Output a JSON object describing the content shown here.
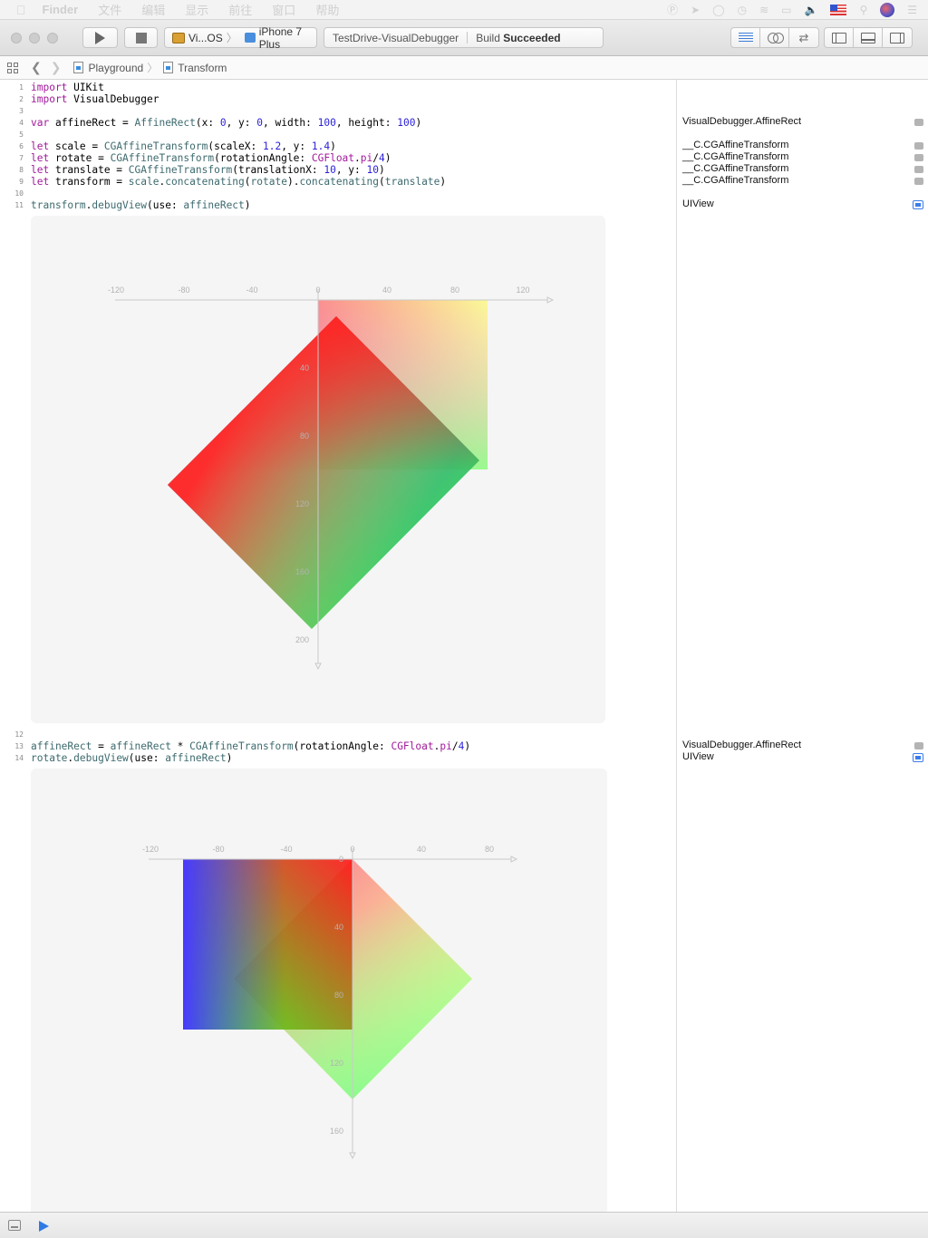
{
  "menubar": {
    "app_name": "Finder",
    "items": [
      "文件",
      "编辑",
      "显示",
      "前往",
      "窗口",
      "帮助"
    ]
  },
  "toolbar": {
    "scheme": "Vi...OS",
    "device": "iPhone 7 Plus",
    "activity_project": "TestDrive-VisualDebugger",
    "activity_status_prefix": "Build",
    "activity_status": "Succeeded"
  },
  "jumpbar": {
    "crumbs": [
      "Playground",
      "Transform"
    ]
  },
  "code": {
    "lines": [
      {
        "n": "1"
      },
      {
        "n": "2"
      },
      {
        "n": "3"
      },
      {
        "n": "4"
      },
      {
        "n": "5"
      },
      {
        "n": "6"
      },
      {
        "n": "7"
      },
      {
        "n": "8"
      },
      {
        "n": "9"
      },
      {
        "n": "10"
      },
      {
        "n": "11"
      },
      {
        "n": "12"
      },
      {
        "n": "13"
      },
      {
        "n": "14"
      }
    ],
    "l1": [
      "import",
      " UIKit"
    ],
    "l2": [
      "import",
      " VisualDebugger"
    ],
    "l4": [
      "var",
      " affineRect = ",
      "AffineRect",
      "(x: ",
      "0",
      ", y: ",
      "0",
      ", width: ",
      "100",
      ", height: ",
      "100",
      ")"
    ],
    "l6": [
      "let",
      " scale = ",
      "CGAffineTransform",
      "(scaleX: ",
      "1.2",
      ", y: ",
      "1.4",
      ")"
    ],
    "l7": [
      "let",
      " rotate = ",
      "CGAffineTransform",
      "(rotationAngle: ",
      "CGFloat",
      ".",
      "pi",
      "/",
      "4",
      ")"
    ],
    "l8": [
      "let",
      " translate = ",
      "CGAffineTransform",
      "(translationX: ",
      "10",
      ", y: ",
      "10",
      ")"
    ],
    "l9": [
      "let",
      " transform = ",
      "scale",
      ".",
      "concatenating",
      "(",
      "rotate",
      ").",
      "concatenating",
      "(",
      "translate",
      ")"
    ],
    "l11": [
      "transform",
      ".",
      "debugView",
      "(use: ",
      "affineRect",
      ")"
    ],
    "l13": [
      "affineRect",
      " = ",
      "affineRect",
      " * ",
      "CGAffineTransform",
      "(rotationAngle: ",
      "CGFloat",
      ".",
      "pi",
      "/",
      "4",
      ")"
    ],
    "l14": [
      "rotate",
      ".",
      "debugView",
      "(use: ",
      "affineRect",
      ")"
    ]
  },
  "results": {
    "r4": "VisualDebugger.AffineRect",
    "r6": "__C.CGAffineTransform",
    "r7": "__C.CGAffineTransform",
    "r8": "__C.CGAffineTransform",
    "r9": "__C.CGAffineTransform",
    "r11": "UIView",
    "r13": "VisualDebugger.AffineRect",
    "r14": "UIView"
  },
  "views": {
    "view1": {
      "x_ticks": [
        "-120",
        "-80",
        "-40",
        "0",
        "40",
        "80",
        "120"
      ],
      "y_ticks": [
        "40",
        "80",
        "120",
        "160",
        "200"
      ]
    },
    "view2": {
      "x_ticks": [
        "-120",
        "-80",
        "-40",
        "0",
        "40",
        "80"
      ],
      "y_ticks": [
        "0",
        "40",
        "80",
        "120",
        "160"
      ]
    }
  },
  "colors": {
    "keyword": "#a1199b",
    "type": "#3d6a6e",
    "number": "#2b1fd8",
    "accent": "#2f7ae5"
  }
}
